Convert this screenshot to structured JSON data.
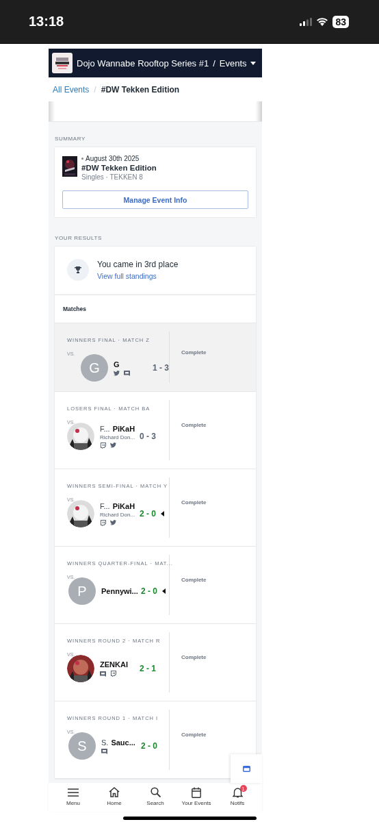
{
  "status_bar": {
    "time": "13:18",
    "battery": "83"
  },
  "header": {
    "title": "Dojo Wannabe Rooftop Series #1",
    "separator": "/",
    "menu": "Events"
  },
  "breadcrumb": {
    "link": "All Events",
    "separator": "/",
    "current": "#DW Tekken Edition"
  },
  "summary": {
    "heading": "SUMMARY",
    "date": "August 30th 2025",
    "title": "#DW Tekken Edition",
    "subtitle": "Singles · TEKKEN 8",
    "button": "Manage Event Info"
  },
  "results": {
    "heading": "YOUR RESULTS",
    "placement": "You came in 3rd place",
    "link": "View full standings"
  },
  "matches": {
    "heading": "Matches",
    "rows": [
      {
        "round": "WINNERS FINAL · MATCH Z",
        "vs": "VS.",
        "avatar": {
          "kind": "letter",
          "initial": "G"
        },
        "prefix": "",
        "name": "G",
        "subtitle": "",
        "socials": [
          {
            "kind": "twitter"
          },
          {
            "kind": "discord"
          }
        ],
        "score": "1 - 3",
        "won": false,
        "marker": false,
        "status": "Complete",
        "selected": true
      },
      {
        "round": "LOSERS FINAL · MATCH BA",
        "vs": "VS.",
        "prefix": "F...",
        "name": "PiKaH",
        "subtitle": "Richard Don...",
        "socials": [
          {
            "kind": "twitch"
          },
          {
            "kind": "twitter"
          }
        ],
        "score": "0 - 3",
        "won": false,
        "marker": false,
        "status": "Complete",
        "selected": false
      },
      {
        "round": "WINNERS SEMI-FINAL · MATCH Y",
        "vs": "VS.",
        "prefix": "F...",
        "name": "PiKaH",
        "subtitle": "Richard Don...",
        "socials": [
          {
            "kind": "twitch"
          },
          {
            "kind": "twitter"
          }
        ],
        "score": "2 - 0",
        "won": true,
        "marker": true,
        "status": "Complete",
        "selected": false
      },
      {
        "round": "WINNERS QUARTER-FINAL · MAT...",
        "vs": "VS.",
        "avatar": {
          "kind": "letter",
          "initial": "P"
        },
        "prefix": "",
        "name": "Pennywi...",
        "subtitle": "",
        "score": "2 - 0",
        "won": true,
        "marker": true,
        "status": "Complete",
        "selected": false
      },
      {
        "round": "WINNERS ROUND 2 · MATCH R",
        "vs": "VS.",
        "prefix": "",
        "name": "ZENKAI",
        "subtitle": "",
        "socials": [
          {
            "kind": "discord"
          },
          {
            "kind": "twitch"
          }
        ],
        "score": "2 - 1",
        "won": true,
        "marker": false,
        "status": "Complete",
        "selected": false
      },
      {
        "round": "WINNERS ROUND 1 · MATCH I",
        "vs": "VS.",
        "avatar": {
          "kind": "letter",
          "initial": "S"
        },
        "prefix": "S.",
        "name": "Sauc...",
        "subtitle": "",
        "socials": [
          {
            "kind": "discord"
          }
        ],
        "score": "2 - 0",
        "won": true,
        "marker": false,
        "status": "Complete",
        "selected": false
      }
    ]
  },
  "bottom_nav": [
    {
      "kind": "menu",
      "label": "Menu"
    },
    {
      "kind": "home",
      "label": "Home"
    },
    {
      "kind": "search",
      "label": "Search"
    },
    {
      "kind": "calendar",
      "label": "Your Events"
    },
    {
      "kind": "bell",
      "label": "Notifs",
      "badge": "1"
    }
  ]
}
